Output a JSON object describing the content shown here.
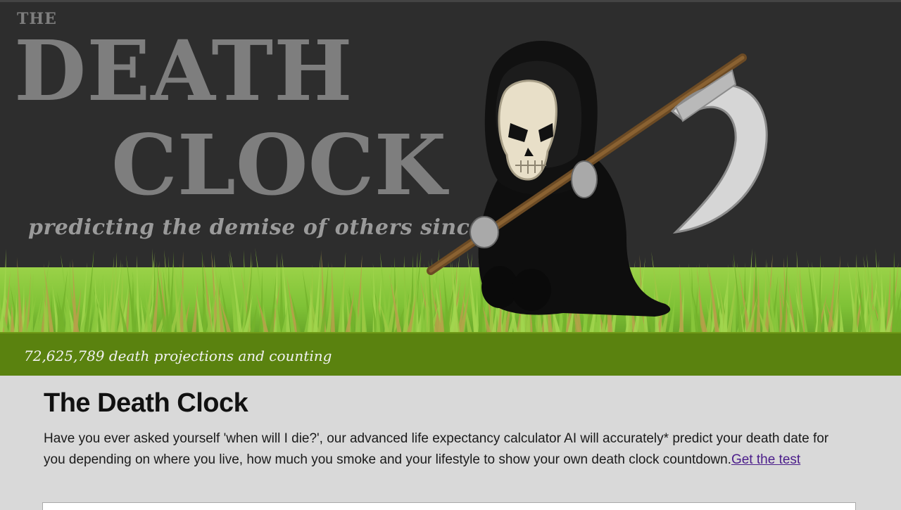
{
  "header": {
    "logo_the": "THE",
    "logo_death": "DEATH",
    "logo_clock": "CLOCK",
    "tagline": "predicting the demise of others since 2006"
  },
  "counter": {
    "text": "72,625,789 death projections and counting"
  },
  "main": {
    "title": "The Death Clock",
    "intro_text": "Have you ever asked yourself 'when will I die?', our advanced life expectancy calculator AI will accurately* predict your death date for you depending on where you live, how much you smoke and your lifestyle to show your own death clock countdown.",
    "cta_link": "Get the test"
  },
  "colors": {
    "header_bg": "#2d2d2d",
    "logo_gray": "#7e7e7e",
    "grass_green": "#7fc236",
    "counter_bar": "#5a820f",
    "content_bg": "#d9d9d9",
    "link": "#4b1d8a"
  },
  "icons": [
    "grim-reaper-illustration",
    "grass-strip"
  ]
}
